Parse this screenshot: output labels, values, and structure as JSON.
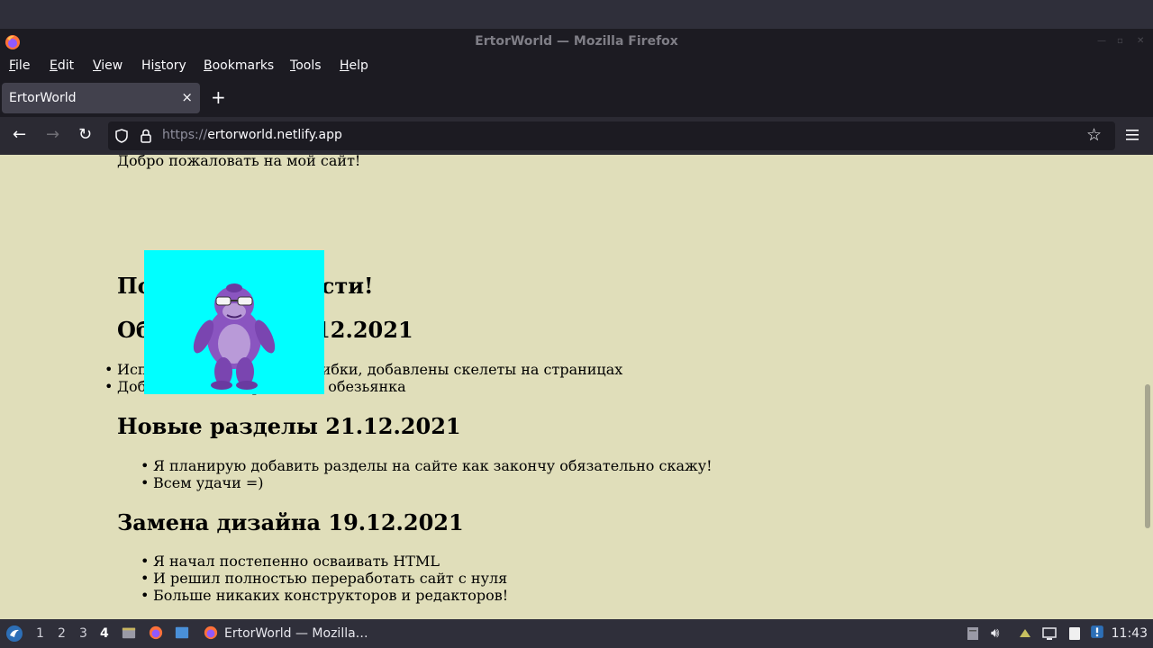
{
  "window": {
    "title": "ErtorWorld — Mozilla Firefox"
  },
  "menu": {
    "file": {
      "first": "F",
      "rest": "ile"
    },
    "edit": {
      "first": "E",
      "rest": "dit"
    },
    "view": {
      "first": "V",
      "rest": "iew"
    },
    "history": {
      "before": "Hi",
      "under": "s",
      "after": "tory"
    },
    "bookmarks": {
      "first": "B",
      "rest": "ookmarks"
    },
    "tools": {
      "first": "T",
      "rest": "ools"
    },
    "help": {
      "first": "H",
      "rest": "elp"
    }
  },
  "tab": {
    "title": "ErtorWorld",
    "close": "×",
    "new_tab": "+"
  },
  "urlbar": {
    "scheme": "https://",
    "host": "ertorworld.netlify.app"
  },
  "page": {
    "welcome": "Добро пожаловать на мой сайт!",
    "heading1": "Последние новости!",
    "section1": {
      "title": "Обновление 25.12.2021",
      "items": [
        "Исправлены все баги и ошибки, добавлены скелеты на страницах",
        "Добавлена анимированная обезьянка"
      ]
    },
    "section2": {
      "title": "Новые разделы 21.12.2021",
      "items": [
        "Я планирую добавить разделы на сайте как закончу обязательно скажу!",
        "Всем удачи =)"
      ]
    },
    "section3": {
      "title": "Замена дизайна 19.12.2021",
      "items": [
        "Я начал постепенно осваивать HTML",
        "И решил полностью переработать сайт с нуля",
        "Больше никаких конструкторов и редакторов!"
      ]
    }
  },
  "taskbar": {
    "workspaces": [
      "1",
      "2",
      "3",
      "4"
    ],
    "active_workspace": "4",
    "task_label": "ErtorWorld — Mozilla…",
    "clock": "11:43"
  },
  "colors": {
    "page_bg": "#e0deba",
    "overlay_bg": "#00ffff",
    "monkey": "#8a55c0"
  }
}
